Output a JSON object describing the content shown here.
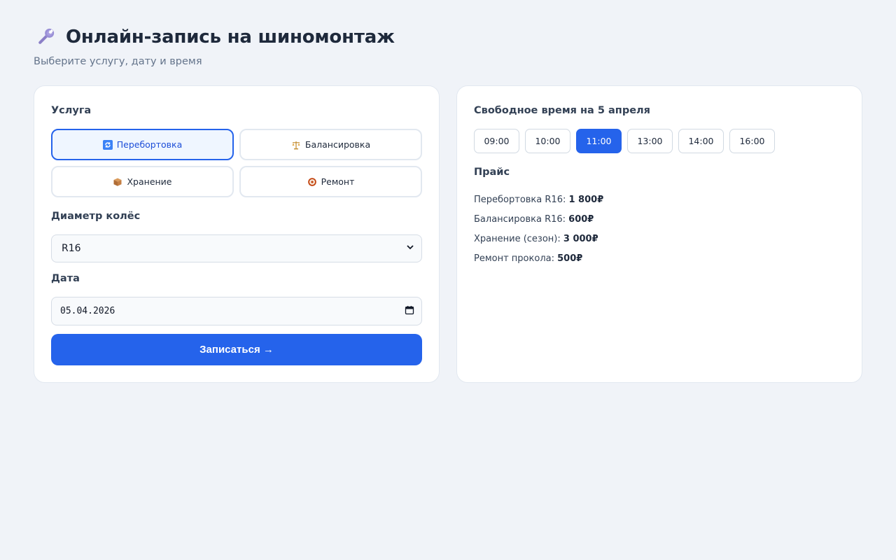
{
  "header": {
    "icon": "wrench-icon",
    "title": "Онлайн-запись на шиномонтаж",
    "subtitle": "Выберите услугу, дату и время"
  },
  "form": {
    "service_label": "Услуга",
    "services": [
      {
        "icon": "refresh-icon",
        "label": "Перебортовка",
        "active": true
      },
      {
        "icon": "scales-icon",
        "label": "Балансировка",
        "active": false
      },
      {
        "icon": "box-icon",
        "label": "Хранение",
        "active": false
      },
      {
        "icon": "tire-icon",
        "label": "Ремонт",
        "active": false
      }
    ],
    "diameter_label": "Диаметр колёс",
    "diameter_value": "R16",
    "date_label": "Дата",
    "date_value": "05.04.2026",
    "submit_label": "Записаться →"
  },
  "schedule": {
    "title": "Свободное время на 5 апреля",
    "slots": [
      "09:00",
      "10:00",
      "11:00",
      "13:00",
      "14:00",
      "16:00"
    ],
    "selected_slot": "11:00"
  },
  "prices": {
    "title": "Прайс",
    "items": [
      {
        "name": "Перебортовка R16:",
        "price": "1 800₽"
      },
      {
        "name": "Балансировка R16:",
        "price": "600₽"
      },
      {
        "name": "Хранение (сезон):",
        "price": "3 000₽"
      },
      {
        "name": "Ремонт прокола:",
        "price": "500₽"
      }
    ]
  },
  "colors": {
    "accent": "#2563eb",
    "background": "#f0f3f8",
    "card": "#ffffff"
  }
}
